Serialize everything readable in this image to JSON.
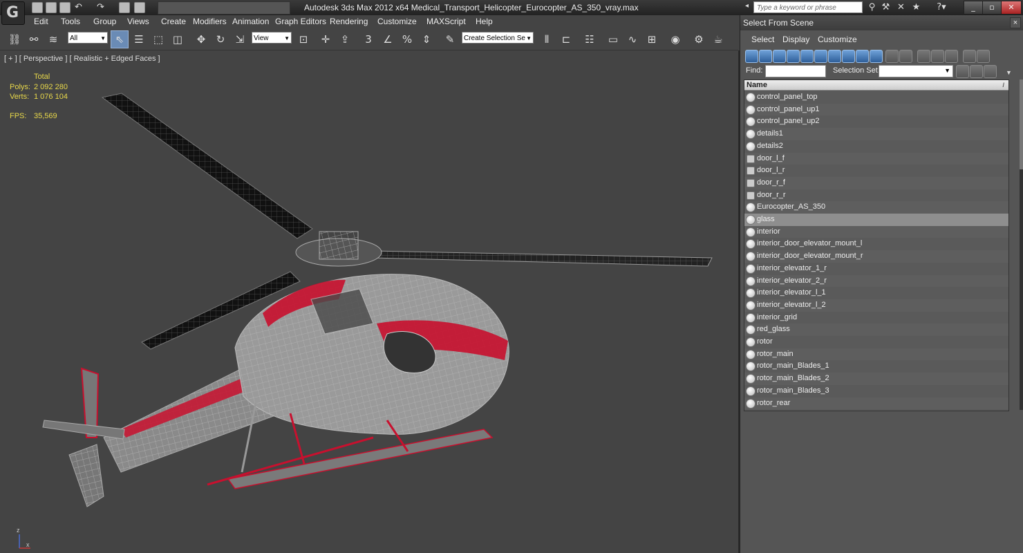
{
  "app": {
    "logo_glyph": "G",
    "title": "Autodesk 3ds Max  2012 x64     Medical_Transport_Helicopter_Eurocopter_AS_350_vray.max",
    "search_placeholder": "Type a keyword or phrase"
  },
  "menus": [
    "Edit",
    "Tools",
    "Group",
    "Views",
    "Create",
    "Modifiers",
    "Animation",
    "Graph Editors",
    "Rendering",
    "Customize",
    "MAXScript",
    "Help"
  ],
  "toolbar": {
    "filter_value": "All",
    "ref_coord_value": "View",
    "selection_set_value": "Create Selection Se",
    "snap_labels": [
      "3",
      "%"
    ]
  },
  "viewport": {
    "label": "[ + ] [ Perspective ] [ Realistic + Edged Faces ]",
    "stats": {
      "header": "Total",
      "polys_label": "Polys:",
      "polys_value": "2 092 280",
      "verts_label": "Verts:",
      "verts_value": "1 076 104",
      "fps_label": "FPS:",
      "fps_value": "35,569"
    },
    "axis_labels": [
      "z",
      "x"
    ]
  },
  "panel": {
    "title": "Select From Scene",
    "close_glyph": "×",
    "menus": [
      "Select",
      "Display",
      "Customize"
    ],
    "find_label": "Find:",
    "selection_set_label": "Selection Set:",
    "list_header": "Name",
    "sort_glyph": "/",
    "selected_item": "glass",
    "items": [
      {
        "name": "control_panel_top",
        "icon": "object-icon"
      },
      {
        "name": "control_panel_up1",
        "icon": "object-icon"
      },
      {
        "name": "control_panel_up2",
        "icon": "object-icon"
      },
      {
        "name": "details1",
        "icon": "object-icon"
      },
      {
        "name": "details2",
        "icon": "object-icon"
      },
      {
        "name": "door_l_f",
        "icon": "group-icon"
      },
      {
        "name": "door_l_r",
        "icon": "group-icon"
      },
      {
        "name": "door_r_f",
        "icon": "group-icon"
      },
      {
        "name": "door_r_r",
        "icon": "group-icon"
      },
      {
        "name": "Eurocopter_AS_350",
        "icon": "object-icon"
      },
      {
        "name": "glass",
        "icon": "object-icon"
      },
      {
        "name": "interior",
        "icon": "object-icon"
      },
      {
        "name": "interior_door_elevator_mount_l",
        "icon": "object-icon"
      },
      {
        "name": "interior_door_elevator_mount_r",
        "icon": "object-icon"
      },
      {
        "name": "interior_elevator_1_r",
        "icon": "object-icon"
      },
      {
        "name": "interior_elevator_2_r",
        "icon": "object-icon"
      },
      {
        "name": "interior_elevator_l_1",
        "icon": "object-icon"
      },
      {
        "name": "interior_elevator_l_2",
        "icon": "object-icon"
      },
      {
        "name": "interior_grid",
        "icon": "object-icon"
      },
      {
        "name": "red_glass",
        "icon": "object-icon"
      },
      {
        "name": "rotor",
        "icon": "object-icon"
      },
      {
        "name": "rotor_main",
        "icon": "object-icon"
      },
      {
        "name": "rotor_main_Blades_1",
        "icon": "object-icon"
      },
      {
        "name": "rotor_main_Blades_2",
        "icon": "object-icon"
      },
      {
        "name": "rotor_main_Blades_3",
        "icon": "object-icon"
      },
      {
        "name": "rotor_rear",
        "icon": "object-icon"
      }
    ]
  },
  "colors": {
    "stats_text": "#e8d84a",
    "helicopter_red": "#c8102e",
    "wire": "#9a9a9a",
    "selection_blue": "#6a8bb5"
  }
}
